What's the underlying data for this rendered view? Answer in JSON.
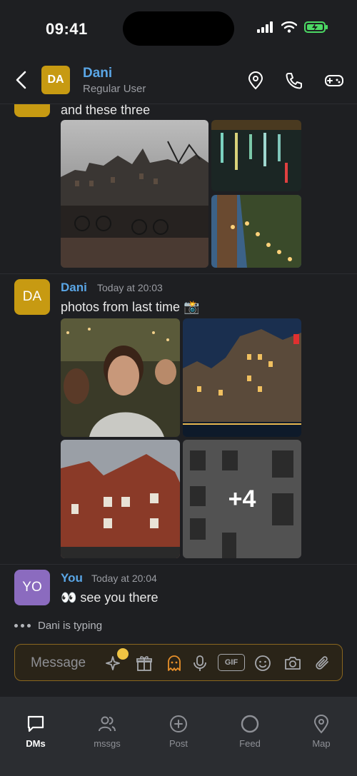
{
  "status_bar": {
    "time": "09:41"
  },
  "header": {
    "avatar_initials": "DA",
    "name": "Dani",
    "subtitle": "Regular User",
    "icons": [
      "location-icon",
      "phone-icon",
      "gamepad-icon"
    ]
  },
  "messages": [
    {
      "author": "",
      "text": "and these three",
      "photos": [
        "amsterdam-street",
        "canal-night-lights",
        "tree-string-lights"
      ]
    },
    {
      "avatar_initials": "DA",
      "author": "Dani",
      "time": "Today at 20:03",
      "text": "photos from last time 📸",
      "photos": [
        "group-selfie",
        "canal-houses-night",
        "brick-building",
        "grey-facade"
      ],
      "more_count": "+4"
    },
    {
      "avatar_initials": "YO",
      "author": "You",
      "time": "Today at 20:04",
      "text": "👀 see you there"
    }
  ],
  "typing_indicator": "Dani is typing",
  "composer": {
    "placeholder": "Message",
    "gif_label": "GIF"
  },
  "nav": [
    {
      "label": "DMs",
      "icon": "chat-bubble-icon",
      "active": true
    },
    {
      "label": "mssgs",
      "icon": "people-icon",
      "active": false
    },
    {
      "label": "Post",
      "icon": "plus-circle-icon",
      "active": false
    },
    {
      "label": "Feed",
      "icon": "circle-icon",
      "active": false
    },
    {
      "label": "Map",
      "icon": "map-pin-icon",
      "active": false
    }
  ],
  "colors": {
    "background": "#1e1f22",
    "accent_name": "#5aa6e6",
    "dani_avatar": "#c79a12",
    "you_avatar": "#8b6bbf",
    "composer_border": "#8a6720"
  }
}
